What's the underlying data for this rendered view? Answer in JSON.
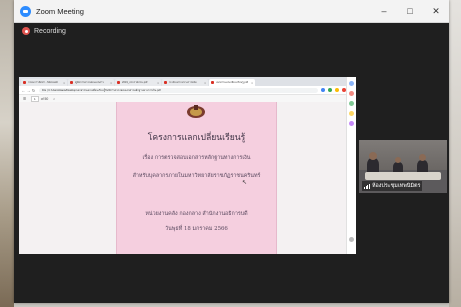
{
  "window": {
    "title": "Zoom Meeting",
    "minimize": "–",
    "maximize": "□",
    "close": "✕"
  },
  "recording": {
    "label": "Recording"
  },
  "browser": {
    "tabs": [
      {
        "label": "กรอบการจัดทำ - Microsoft",
        "active": false
      },
      {
        "label": "คู่มือการตรวจสอบเอกสาร",
        "active": false
      },
      {
        "label": "2019_ประกาศกรม.pdf",
        "active": false
      },
      {
        "label": "ระเบียบกระทรวงการคลัง",
        "active": false
      },
      {
        "label": "เอกสารแลกเปลี่ยนเรียนรู้.pdf",
        "active": true
      }
    ],
    "url": "File | C:/Users/Haew/Desktop/เอกสาร/แลกเปลี่ยนเรียนรู้%20การตรวจสอบเอกสารหลักฐานทางการเงิน.pdf",
    "pdf_page": "1",
    "pdf_total": "of 50"
  },
  "document": {
    "title": "โครงการแลกเปลี่ยนเรียนรู้",
    "subtitle1": "เรื่อง การตรวจสอบเอกสารหลักฐานทางการเงิน",
    "subtitle2": "สำหรับบุคลากรภายในมหาวิทยาลัยราชภัฏราชนครินทร์",
    "org": "หน่วยงานคลัง กองกลาง สำนักงานอธิการบดี",
    "date": "วันพุธที่ 18 มกราคม 2566"
  },
  "participant": {
    "name": "ห้องประชุมเทพนิมิตร"
  },
  "colors": {
    "zoom_bg": "#1f1f1f",
    "recording": "#e0544f",
    "pdf_page": "#f5cfdf",
    "zoom_blue": "#2d8cff"
  }
}
